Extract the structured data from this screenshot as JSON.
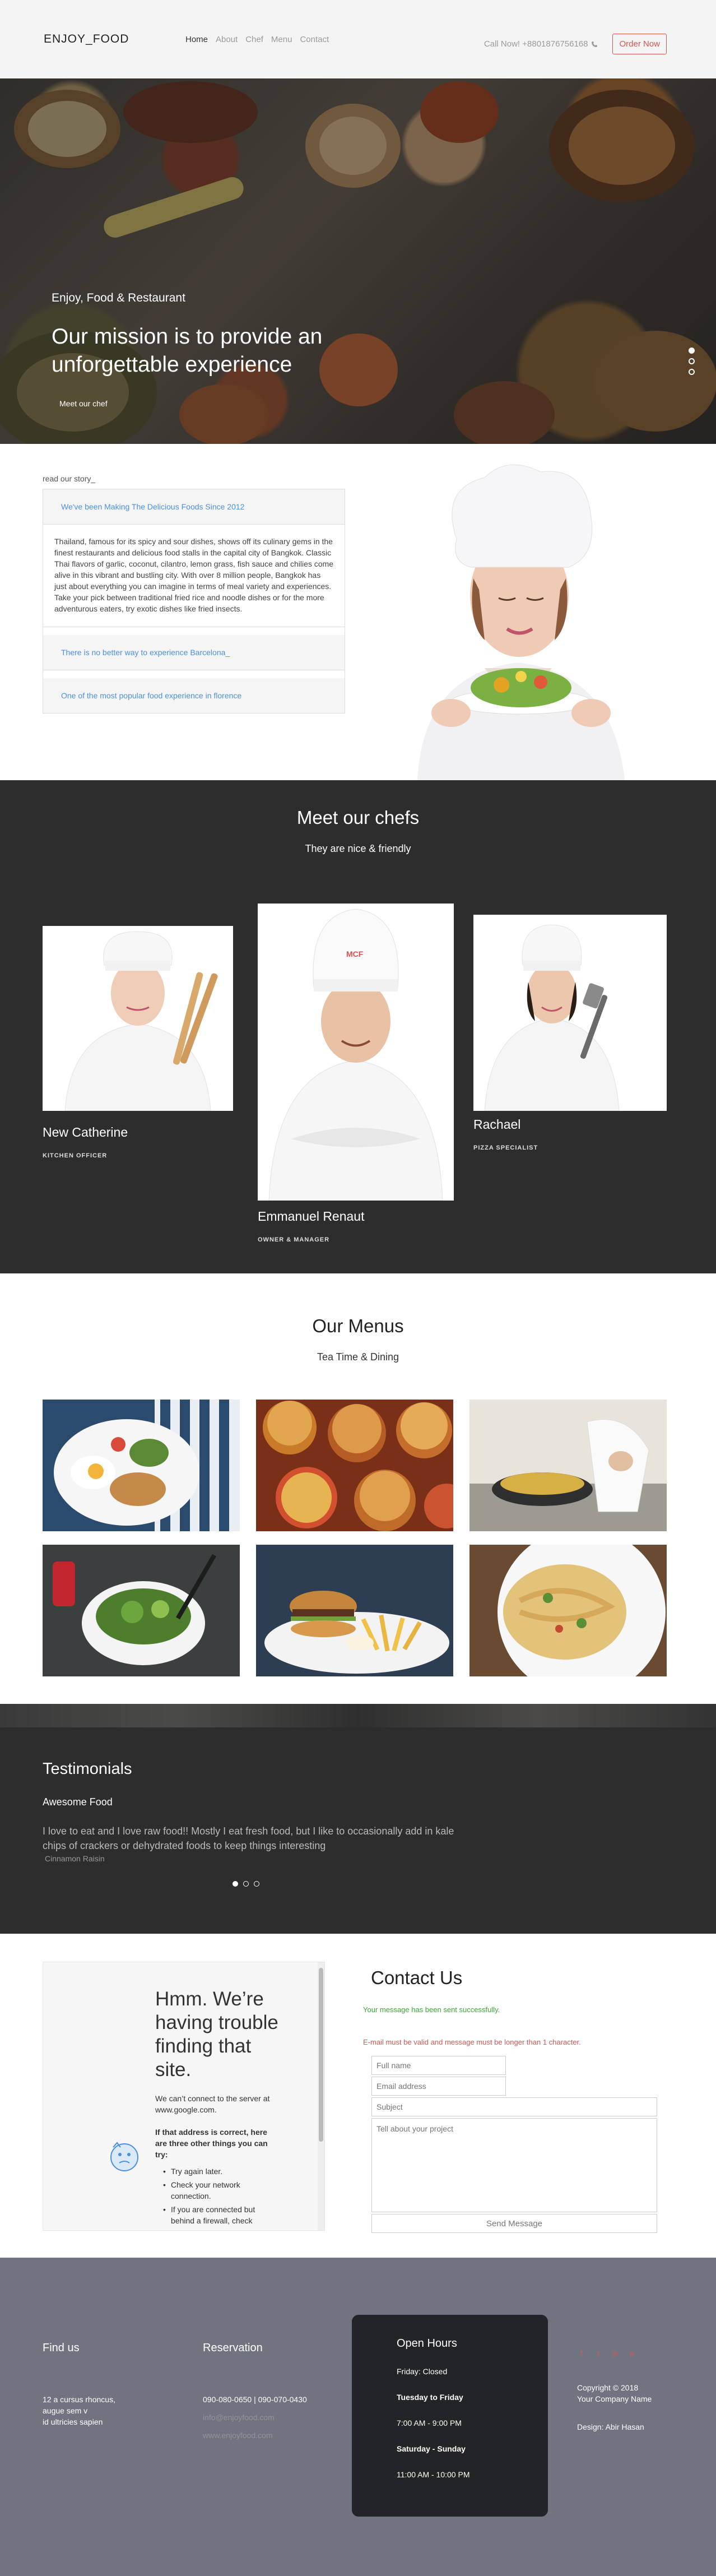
{
  "nav": {
    "logo": "ENJOY_FOOD",
    "items": [
      {
        "label": "Home"
      },
      {
        "label": "About"
      },
      {
        "label": "Chef"
      },
      {
        "label": "Menu"
      },
      {
        "label": "Contact"
      }
    ],
    "phone": "Call Now! +8801876756168",
    "order_label": "Order Now"
  },
  "hero": {
    "subtitle": "Enjoy, Food & Restaurant",
    "title": "Our mission is to provide an unforgettable experience",
    "link": "Meet our chef"
  },
  "story": {
    "label": "read our story_",
    "sections": [
      {
        "heading": "We've been Making The Delicious Foods Since 2012",
        "body": "Thailand, famous for its spicy and sour dishes, shows off its culinary gems in the finest restaurants and delicious food stalls in the capital city of Bangkok. Classic Thai flavors of garlic, coconut, cilantro, lemon grass, fish sauce and chilies come alive in this vibrant and bustling city. With over 8 million people, Bangkok has just about everything you can imagine in terms of meal variety and experiences. Take your pick between traditional fried rice and noodle dishes or for the more adventurous eaters, try exotic dishes like fried insects."
      },
      {
        "heading": "There is no better way to experience Barcelona_"
      },
      {
        "heading": "One of the most popular food experience in florence"
      }
    ]
  },
  "chefs": {
    "title": "Meet our chefs",
    "subtitle": "They are nice & friendly",
    "list": [
      {
        "name": "New Catherine",
        "role": "KITCHEN OFFICER"
      },
      {
        "name": "Emmanuel Renaut",
        "role": "OWNER & MANAGER"
      },
      {
        "name": "Rachael",
        "role": "PIZZA SPECIALIST"
      }
    ]
  },
  "menus": {
    "title": "Our Menus",
    "subtitle": "Tea Time & Dining"
  },
  "testimonials": {
    "title": "Testimonials",
    "subtitle": "Awesome Food",
    "quote": "I love to eat and I love raw food!! Mostly I eat fresh food, but I like to occasionally add in kale chips of crackers or dehydrated foods to keep things interesting",
    "author": "Cinnamon Raisin"
  },
  "contact": {
    "title": "Contact Us",
    "success_msg": "Your message has been sent successfully.",
    "error_msg": "E-mail must be valid and message must be longer than 1 character.",
    "fullname_placeholder": "Full name",
    "email_placeholder": "Email address",
    "subject_placeholder": "Subject",
    "message_placeholder": "Tell about your project",
    "send_label": "Send Message",
    "iframe": {
      "title": "Hmm. We’re having trouble finding that site.",
      "p1": "We can’t connect to the server at www.google.com.",
      "bold": "If that address is correct, here are three other things you can try:",
      "items": [
        "Try again later.",
        "Check your network connection.",
        "If you are connected but behind a firewall, check"
      ]
    }
  },
  "footer": {
    "find_title": "Find us",
    "address": [
      "12 a cursus rhoncus,",
      "augue sem v",
      "id ultricies sapien"
    ],
    "reservation_title": "Reservation",
    "phones": "090-080-0650 | 090-070-0430",
    "email": "info@enjoyfood.com",
    "site": "www.enjoyfood.com",
    "hours_title": "Open Hours",
    "hours": [
      {
        "text": "Friday: Closed",
        "bold": false
      },
      {
        "text": "Tuesday to Friday",
        "bold": true
      },
      {
        "text": "7:00 AM - 9:00 PM",
        "bold": false
      },
      {
        "text": "Saturday - Sunday",
        "bold": true
      },
      {
        "text": "11:00 AM - 10:00 PM",
        "bold": false
      }
    ],
    "copyright": [
      "Copyright © 2018",
      "Your Company Name"
    ],
    "design": "Design: Abir Hasan",
    "social_icons": [
      "facebook-icon",
      "twitter-icon",
      "instagram-icon",
      "pinterest-icon"
    ]
  },
  "colors": {
    "accent": "#d9534f",
    "link_blue": "#4a90e2",
    "dark_section": "#2d2d2d",
    "footer": "#707480"
  }
}
